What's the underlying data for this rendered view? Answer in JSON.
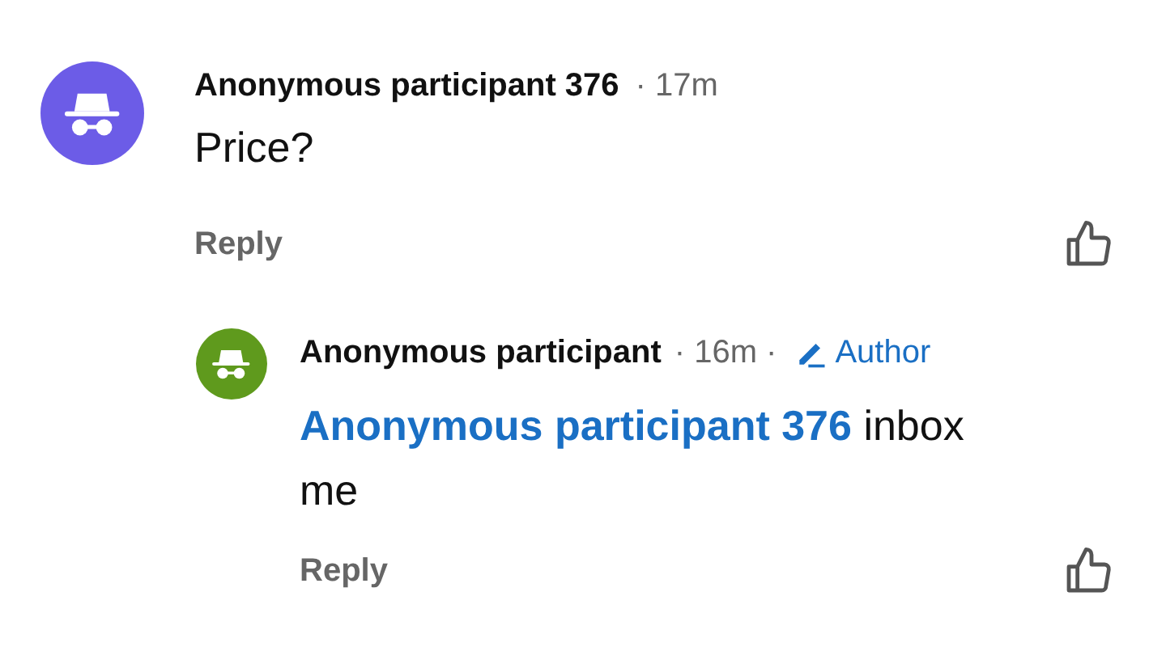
{
  "comments": [
    {
      "author": "Anonymous participant 376",
      "time": "· 17m",
      "color": "#6c5ce7",
      "text": "Price?",
      "reply_label": "Reply",
      "replies": [
        {
          "author": "Anonymous participant",
          "time": "· 16m ·",
          "color": "#5f9a1d",
          "badge": "Author",
          "mention": "Anonymous participant 376",
          "text": "inbox me",
          "reply_label": "Reply"
        }
      ]
    }
  ]
}
